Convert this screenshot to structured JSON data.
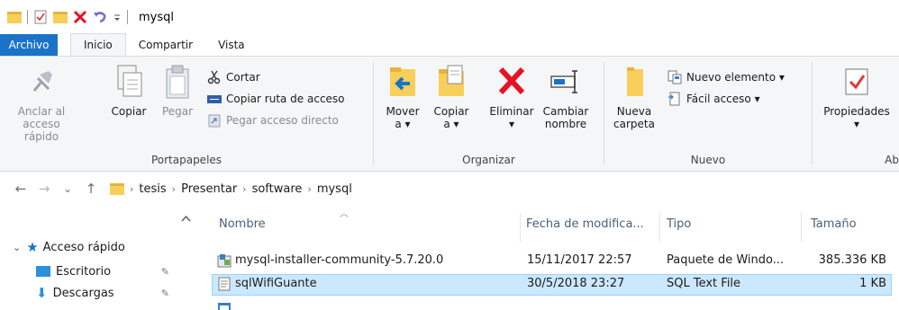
{
  "window": {
    "title": "mysql"
  },
  "quick_access": {
    "icons": [
      "folder-icon",
      "properties-icon",
      "new-folder-icon",
      "delete-icon",
      "undo-icon",
      "customize-dropdown-icon"
    ]
  },
  "ribbon": {
    "tabs": [
      "Archivo",
      "Inicio",
      "Compartir",
      "Vista"
    ],
    "active_tab": "Inicio",
    "clipboard": {
      "label": "Portapapeles",
      "pin_line1": "Anclar al",
      "pin_line2": "acceso rápido",
      "copy": "Copiar",
      "paste": "Pegar",
      "cut": "Cortar",
      "copy_path": "Copiar ruta de acceso",
      "paste_shortcut": "Pegar acceso directo"
    },
    "organize": {
      "label": "Organizar",
      "move_line1": "Mover",
      "move_line2": "a ▾",
      "copy_line1": "Copiar",
      "copy_line2": "a ▾",
      "delete_line1": "Eliminar",
      "delete_line2": "▾",
      "rename_line1": "Cambiar",
      "rename_line2": "nombre"
    },
    "new": {
      "label": "Nuevo",
      "folder_line1": "Nueva",
      "folder_line2": "carpeta",
      "new_item": "Nuevo elemento ▾",
      "easy_access": "Fácil acceso ▾"
    },
    "open": {
      "label": "Ab",
      "properties": "Propiedades",
      "properties_arrow": "▾"
    }
  },
  "address": {
    "back": "←",
    "forward": "→",
    "recent": "⌄",
    "up": "↑",
    "crumbs": [
      "tesis",
      "Presentar",
      "software",
      "mysql"
    ]
  },
  "nav_pane": {
    "quick_access": "Acceso rápido",
    "items": [
      "Escritorio",
      "Descargas"
    ]
  },
  "file_list": {
    "columns": [
      "Nombre",
      "Fecha de modifica...",
      "Tipo",
      "Tamaño"
    ],
    "rows": [
      {
        "name": "mysql-installer-community-5.7.20.0",
        "date": "15/11/2017 22:57",
        "type": "Paquete de Windo...",
        "size": "385.336 KB"
      },
      {
        "name": "sqlWifiGuante",
        "date": "30/5/2018 23:27",
        "type": "SQL Text File",
        "size": "1 KB"
      }
    ]
  },
  "colors": {
    "file_tab": "#1a73c8",
    "selection": "#cce8ff",
    "folder": "#f7cf5b",
    "delete_red": "#e81123"
  }
}
